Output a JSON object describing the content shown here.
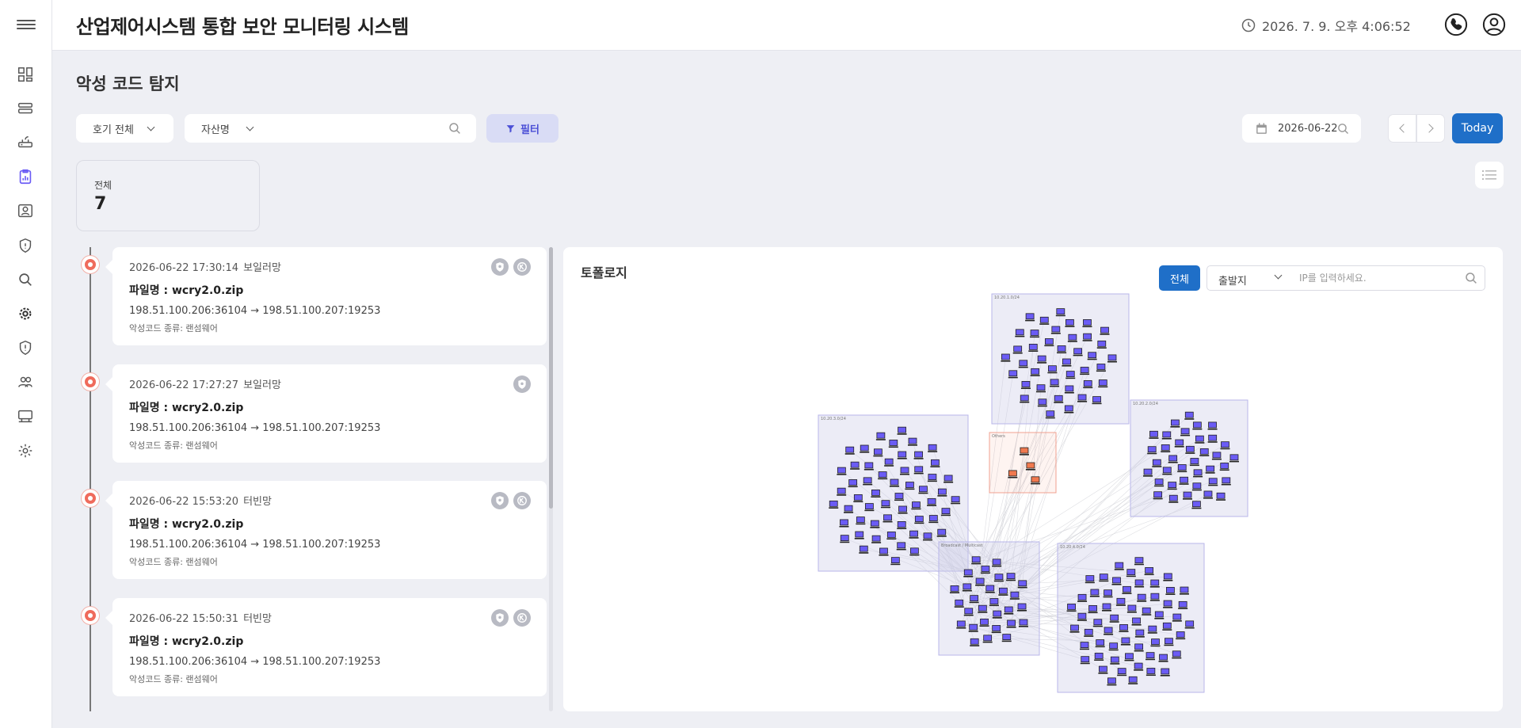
{
  "header": {
    "title": "산업제어시스템 통합 보안 모니터링 시스템",
    "clock": "2026. 7. 9. 오후 4:06:52"
  },
  "sidebar": {
    "icons": [
      "dashboard-icon",
      "layers-icon",
      "router-icon",
      "report-icon",
      "monitor-user-icon",
      "shield-icon",
      "search-icon",
      "gear-badge-icon",
      "shield-alert-icon",
      "users-icon",
      "board-icon",
      "settings-icon"
    ],
    "active_index": 3
  },
  "page": {
    "title": "악성 코드 탐지"
  },
  "filters": {
    "unit_select": "호기 전체",
    "asset_select": "자산명",
    "asset_search": {
      "value": "",
      "placeholder": ""
    },
    "filter_button": "필터",
    "date": "2026-06-22",
    "today_button": "Today"
  },
  "summary": {
    "label": "전체",
    "value": "7"
  },
  "events": [
    {
      "time": "2026-06-22 17:30:14",
      "network": "보일러망",
      "file_label": "파일명 : wcry2.0.zip",
      "flow": "198.51.100.206:36104 → 198.51.100.207:19253",
      "type_label": "악성코드 종류: 랜섬웨어",
      "icons": [
        "shield-virus-icon",
        "blocked-icon"
      ]
    },
    {
      "time": "2026-06-22 17:27:27",
      "network": "보일러망",
      "file_label": "파일명 : wcry2.0.zip",
      "flow": "198.51.100.206:36104 → 198.51.100.207:19253",
      "type_label": "악성코드 종류: 랜섬웨어",
      "icons": [
        "shield-virus-icon"
      ]
    },
    {
      "time": "2026-06-22 15:53:20",
      "network": "터빈망",
      "file_label": "파일명 : wcry2.0.zip",
      "flow": "198.51.100.206:36104 → 198.51.100.207:19253",
      "type_label": "악성코드 종류: 랜섬웨어",
      "icons": [
        "shield-virus-icon",
        "blocked-icon"
      ]
    },
    {
      "time": "2026-06-22 15:50:31",
      "network": "터빈망",
      "file_label": "파일명 : wcry2.0.zip",
      "flow": "198.51.100.206:36104 → 198.51.100.207:19253",
      "type_label": "악성코드 종류: 랜섬웨어",
      "icons": [
        "shield-virus-icon",
        "blocked-icon"
      ]
    }
  ],
  "topology": {
    "title": "토폴로지",
    "all_button": "전체",
    "source_select": "출발지",
    "ip_search": {
      "value": "",
      "placeholder": "IP를 입력하세요."
    },
    "groups": [
      {
        "label": "10.20.1.0/24",
        "node_count": 42,
        "color": "#6b5cf5"
      },
      {
        "label": "10.20.3.0/24",
        "node_count": 58,
        "color": "#6b5cf5"
      },
      {
        "label": "Others",
        "node_count": 4,
        "color": "#f0794f"
      },
      {
        "label": "10.20.2.0/24",
        "node_count": 38,
        "color": "#6b5cf5"
      },
      {
        "label": "Broadcast / Multicast",
        "node_count": 30,
        "color": "#6b5cf5"
      },
      {
        "label": "10.20.4.0/24",
        "node_count": 62,
        "color": "#6b5cf5"
      }
    ]
  },
  "colors": {
    "accent": "#1f6fc8",
    "alert_dot": "#ef6b5c",
    "filter_bg": "#d9dcf5",
    "node": "#6b5cf5",
    "node_alert": "#f0794f"
  }
}
